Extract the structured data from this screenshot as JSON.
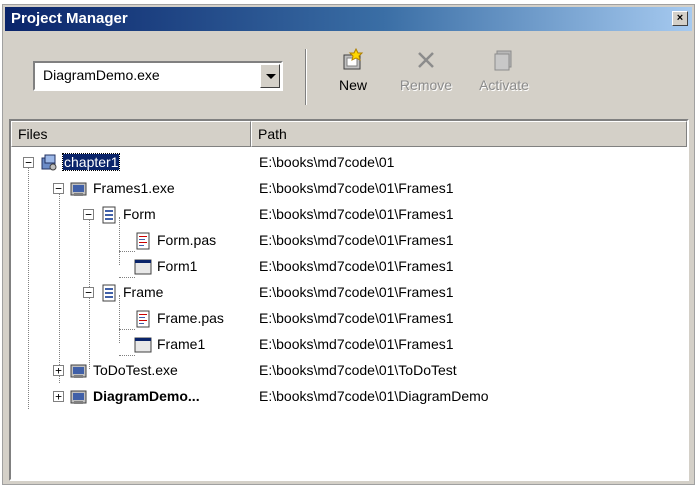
{
  "window": {
    "title": "Project Manager",
    "close_glyph": "×"
  },
  "toolbar": {
    "combo_value": "DiagramDemo.exe",
    "new_label": "New",
    "remove_label": "Remove",
    "activate_label": "Activate",
    "new_icon": "new-project-icon",
    "remove_icon": "remove-x-icon",
    "activate_icon": "activate-icon"
  },
  "columns": {
    "files": "Files",
    "path": "Path"
  },
  "rows": [
    {
      "name": "chapter1",
      "path": "E:\\books\\md7code\\01",
      "expander": "⊟",
      "icon": "project-group-icon"
    },
    {
      "name": "Frames1.exe",
      "path": "E:\\books\\md7code\\01\\Frames1",
      "expander": "⊟",
      "icon": "project-exe-icon"
    },
    {
      "name": "Form",
      "path": "E:\\books\\md7code\\01\\Frames1",
      "expander": "⊟",
      "icon": "unit-icon"
    },
    {
      "name": "Form.pas",
      "path": "E:\\books\\md7code\\01\\Frames1",
      "icon": "pas-file-icon"
    },
    {
      "name": "Form1",
      "path": "E:\\books\\md7code\\01\\Frames1",
      "icon": "form-icon"
    },
    {
      "name": "Frame",
      "path": "E:\\books\\md7code\\01\\Frames1",
      "expander": "⊟",
      "icon": "unit-icon"
    },
    {
      "name": "Frame.pas",
      "path": "E:\\books\\md7code\\01\\Frames1",
      "icon": "pas-file-icon"
    },
    {
      "name": "Frame1",
      "path": "E:\\books\\md7code\\01\\Frames1",
      "icon": "form-icon"
    },
    {
      "name": "ToDoTest.exe",
      "path": "E:\\books\\md7code\\01\\ToDoTest",
      "expander": "⊞",
      "icon": "project-exe-icon"
    },
    {
      "name": "DiagramDemo...",
      "path": "E:\\books\\md7code\\01\\DiagramDemo",
      "expander": "⊞",
      "icon": "project-exe-icon"
    }
  ],
  "colors": {
    "selection": "#0a246a",
    "titlebar": "#0a246a",
    "face": "#d4d0c8"
  }
}
